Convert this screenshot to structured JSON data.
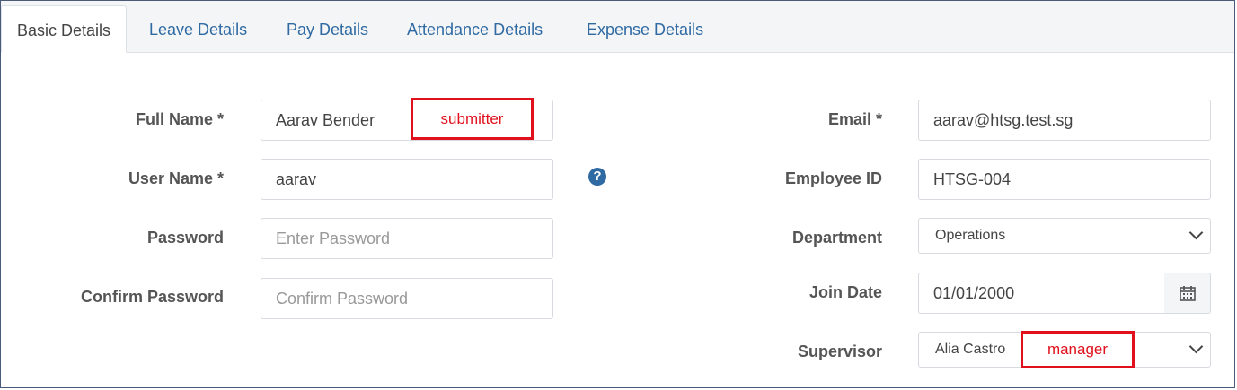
{
  "tabs": [
    {
      "label": "Basic Details",
      "active": true
    },
    {
      "label": "Leave Details",
      "active": false
    },
    {
      "label": "Pay Details",
      "active": false
    },
    {
      "label": "Attendance Details",
      "active": false
    },
    {
      "label": "Expense Details",
      "active": false
    }
  ],
  "left": {
    "full_name": {
      "label": "Full Name *",
      "value": "Aarav Bender"
    },
    "user_name": {
      "label": "User Name *",
      "value": "aarav"
    },
    "password": {
      "label": "Password",
      "value": "",
      "placeholder": "Enter Password"
    },
    "confirm_password": {
      "label": "Confirm Password",
      "value": "",
      "placeholder": "Confirm Password"
    }
  },
  "right": {
    "email": {
      "label": "Email *",
      "value": "aarav@htsg.test.sg"
    },
    "employee_id": {
      "label": "Employee ID",
      "value": "HTSG-004"
    },
    "department": {
      "label": "Department",
      "value": "Operations"
    },
    "join_date": {
      "label": "Join Date",
      "value": "01/01/2000"
    },
    "supervisor": {
      "label": "Supervisor",
      "value": "Alia Castro"
    }
  },
  "help_icon": {
    "glyph": "?"
  },
  "annotations": {
    "submitter": "submitter",
    "manager": "manager",
    "color": "#e0101c"
  },
  "colors": {
    "tab_link": "#2f6aa3",
    "frame": "#4a5a78"
  }
}
